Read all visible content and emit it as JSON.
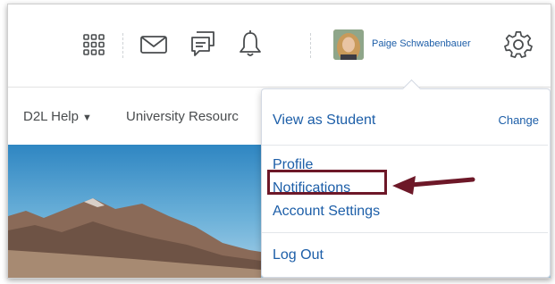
{
  "header": {
    "username": "Paige Schwabenbauer",
    "icons": [
      "grid-icon",
      "mail-icon",
      "chat-icon",
      "bell-icon",
      "gear-icon"
    ]
  },
  "nav": {
    "help_label": "D2L Help",
    "resources_label": "University Resourc"
  },
  "dropdown": {
    "view_as_student": "View as Student",
    "change": "Change",
    "profile": "Profile",
    "notifications": "Notifications",
    "account_settings": "Account Settings",
    "log_out": "Log Out"
  },
  "colors": {
    "link": "#1c5ea8",
    "highlight": "#6d1828"
  }
}
